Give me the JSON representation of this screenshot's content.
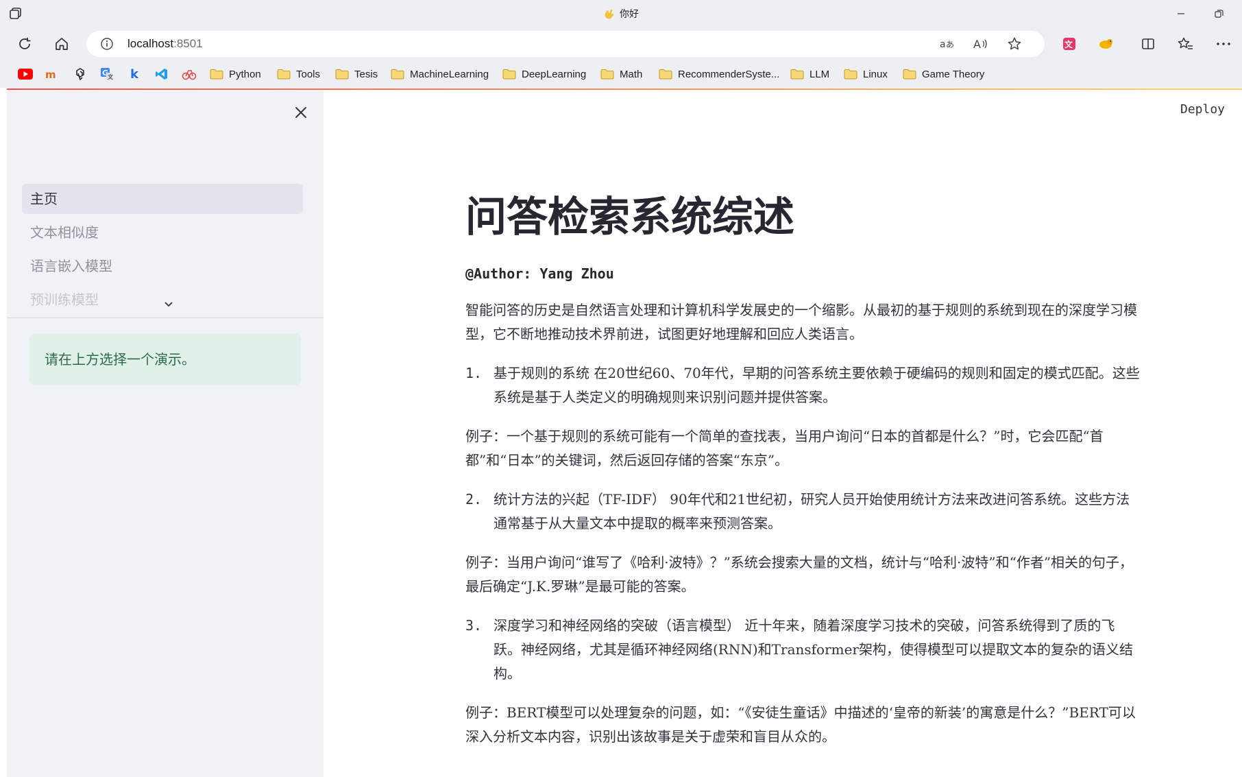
{
  "browser": {
    "tab_title": "你好",
    "address": {
      "host": "localhost",
      "port": ":8501"
    },
    "bookmarks": [
      {
        "label": "Python"
      },
      {
        "label": "Tools"
      },
      {
        "label": "Tesis"
      },
      {
        "label": "MachineLearning"
      },
      {
        "label": "DeepLearning"
      },
      {
        "label": "Math"
      },
      {
        "label": "RecommenderSyste..."
      },
      {
        "label": "LLM"
      },
      {
        "label": "Linux"
      },
      {
        "label": "Game Theory"
      }
    ],
    "icons": {
      "workspaces": "workspaces-icon",
      "refresh": "refresh-icon",
      "home": "home-icon",
      "info": "info-icon",
      "translate": "translate-icon",
      "read_aloud": "read-aloud-icon",
      "favorite": "star-icon",
      "split": "split-screen-icon",
      "favorites_list": "favorites-icon",
      "more": "more-icon"
    }
  },
  "app": {
    "deploy_label": "Deploy",
    "sidebar": {
      "nav": [
        {
          "label": "主页",
          "active": true
        },
        {
          "label": "文本相似度",
          "active": false
        },
        {
          "label": "语言嵌入模型",
          "active": false
        },
        {
          "label": "预训练模型",
          "active": false
        }
      ],
      "info_message": "请在上方选择一个演示。"
    },
    "main": {
      "title": "问答检索系统综述",
      "author": "@Author: Yang Zhou",
      "intro": "智能问答的历史是自然语言处理和计算机科学发展史的一个缩影。从最初的基于规则的系统到现在的深度学习模型，它不断地推动技术界前进，试图更好地理解和回应人类语言。",
      "sections": [
        {
          "num": "1.",
          "text": "基于规则的系统  在20世纪60、70年代，早期的问答系统主要依赖于硬编码的规则和固定的模式匹配。这些系统是基于人类定义的明确规则来识别问题并提供答案。",
          "example": "例子：一个基于规则的系统可能有一个简单的查找表，当用户询问“日本的首都是什么？”时，它会匹配“首都”和“日本”的关键词，然后返回存储的答案“东京”。"
        },
        {
          "num": "2.",
          "text": "统计方法的兴起（TF-IDF） 90年代和21世纪初，研究人员开始使用统计方法来改进问答系统。这些方法通常基于从大量文本中提取的概率来预测答案。",
          "example": "例子：当用户询问“谁写了《哈利·波特》？”系统会搜索大量的文档，统计与“哈利·波特”和“作者”相关的句子，最后确定“J.K.罗琳”是最可能的答案。"
        },
        {
          "num": "3.",
          "text": "深度学习和神经网络的突破（语言模型） 近十年来，随着深度学习技术的突破，问答系统得到了质的飞跃。神经网络，尤其是循环神经网络(RNN)和Transformer架构，使得模型可以提取文本的复杂的语义结构。",
          "example": "例子：BERT模型可以处理复杂的问题，如：“《安徒生童话》中描述的‘皇帝的新装’的寓意是什么？”BERT可以深入分析文本内容，识别出该故事是关于虚荣和盲目从众的。"
        }
      ]
    }
  }
}
